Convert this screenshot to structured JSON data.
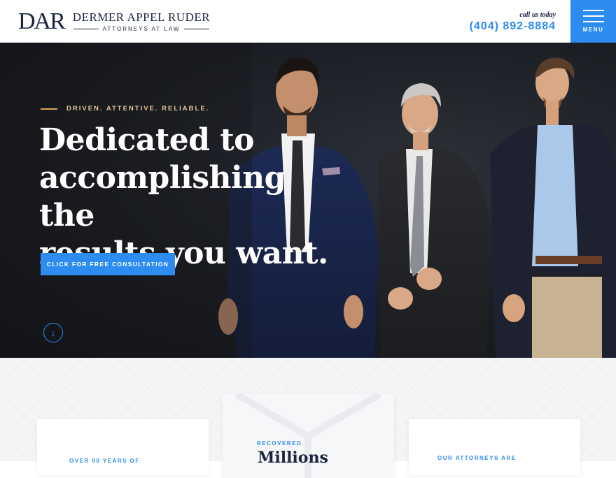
{
  "header": {
    "logo_mark": "DAR",
    "logo_name": "DERMER APPEL RUDER",
    "logo_sub": "ATTORNEYS AT LAW",
    "call_label": "call us today",
    "phone": "(404) 892-8884",
    "menu_label": "MENU"
  },
  "hero": {
    "tagline": "DRIVEN. ATTENTIVE. RELIABLE.",
    "headline_lines": [
      "Dedicated to",
      "accomplishing the",
      "results you want."
    ],
    "cta_label": "CLICK FOR FREE CONSULTATION",
    "scroll_icon": "arrow-down-circle-icon"
  },
  "stats": [
    {
      "kicker": "OVER 90 YEARS OF"
    },
    {
      "kicker": "RECOVERED",
      "big": "Millions"
    },
    {
      "kicker": "OUR ATTORNEYS ARE"
    }
  ],
  "colors": {
    "accent": "#2d8cf0",
    "navy": "#1b2540",
    "gold": "#d9a35e"
  }
}
